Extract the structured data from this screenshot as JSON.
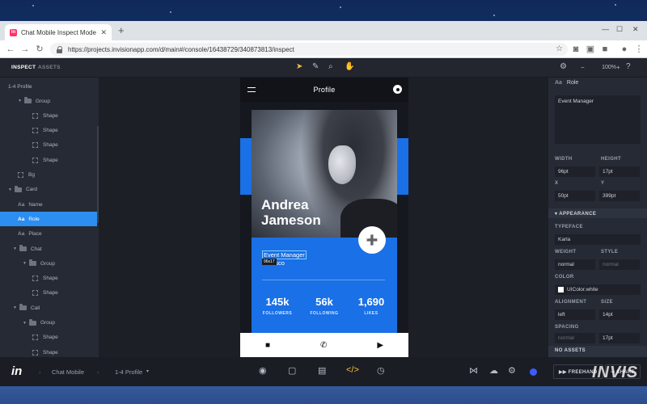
{
  "browser": {
    "tab_title": "Chat Mobile Inspect Mode - In",
    "favicon_text": "in",
    "url": "https://projects.invisionapp.com/d/main#/console/16438729/340873813/inspect"
  },
  "toolbar": {
    "tabs": [
      "INSPECT",
      "ASSETS"
    ],
    "zoom": "100%"
  },
  "layers": {
    "root": "1-4 Profile",
    "items": [
      {
        "label": "Group",
        "kind": "folder"
      },
      {
        "label": "Shape",
        "kind": "shape"
      },
      {
        "label": "Shape",
        "kind": "shape"
      },
      {
        "label": "Shape",
        "kind": "shape"
      },
      {
        "label": "Shape",
        "kind": "shape"
      },
      {
        "label": "Bg",
        "kind": "shape"
      },
      {
        "label": "Card",
        "kind": "folder"
      },
      {
        "label": "Name",
        "kind": "text"
      },
      {
        "label": "Role",
        "kind": "text",
        "selected": true
      },
      {
        "label": "Place",
        "kind": "text"
      },
      {
        "label": "Chat",
        "kind": "folder"
      },
      {
        "label": "Group",
        "kind": "folder"
      },
      {
        "label": "Shape",
        "kind": "shape"
      },
      {
        "label": "Shape",
        "kind": "shape"
      },
      {
        "label": "Call",
        "kind": "folder"
      },
      {
        "label": "Group",
        "kind": "folder"
      },
      {
        "label": "Shape",
        "kind": "shape"
      },
      {
        "label": "Shape",
        "kind": "shape"
      }
    ]
  },
  "phone": {
    "title": "Profile",
    "name_line1": "Andrea",
    "name_line2": "Jameson",
    "role": "Event Manager",
    "place": "rancisco",
    "dim_tag": "96x17",
    "stats": [
      {
        "value": "145k",
        "label": "FOLLOWERS"
      },
      {
        "value": "56k",
        "label": "FOLLOWING"
      },
      {
        "value": "1,690",
        "label": "LIKES"
      }
    ]
  },
  "props": {
    "layer_label": "Role",
    "text_content": "Event Manager",
    "width_label": "WIDTH",
    "width": "96pt",
    "height_label": "HEIGHT",
    "height": "17pt",
    "x_label": "X",
    "x": "50pt",
    "y_label": "Y",
    "y": "399pt",
    "appearance": "APPEARANCE",
    "typeface_label": "TYPEFACE",
    "typeface": "Karla",
    "weight_label": "WEIGHT",
    "weight": "normal",
    "style_label": "STYLE",
    "style": "normal",
    "color_label": "COLOR",
    "color": "UIColor.white",
    "alignment_label": "ALIGNMENT",
    "alignment": "left",
    "size_label": "SIZE",
    "size": "14pt",
    "spacing_label": "SPACING",
    "spacing": "normal",
    "line_height": "17pt",
    "no_assets": "NO ASSETS"
  },
  "bottombar": {
    "logo": "in",
    "crumb1": "Chat Mobile",
    "crumb2": "1-4 Profile",
    "freehand": "FREEHAND",
    "share": "SHARE"
  },
  "watermark": "INVIS",
  "colors": {
    "accent": "#2b8ef0",
    "card_blue": "#1a70e6",
    "active_tool": "#f5c041"
  }
}
